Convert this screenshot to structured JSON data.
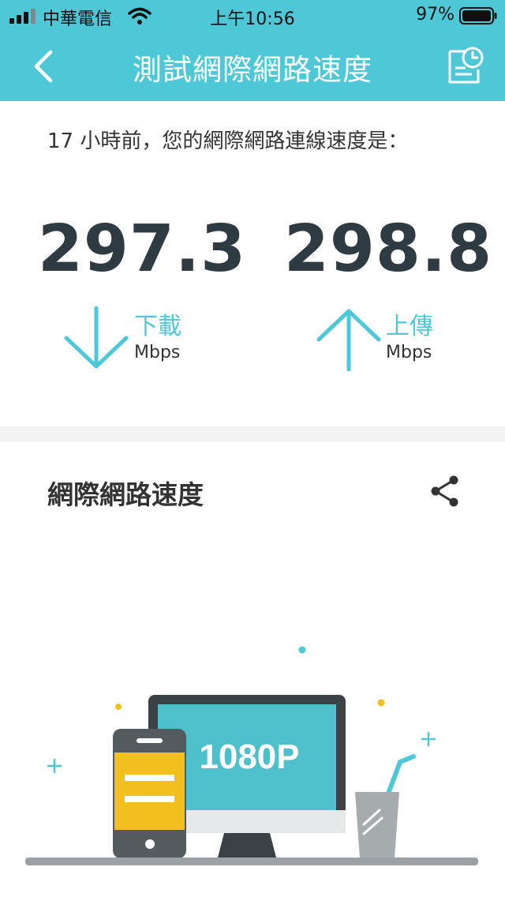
{
  "status_bar": {
    "carrier": "中華電信",
    "time": "上午10:56",
    "battery": "97%"
  },
  "header": {
    "title": "測試網際網路速度",
    "back_icon": "chevron-left-icon",
    "history_icon": "history-report-icon"
  },
  "result": {
    "subtitle": "17 小時前，您的網際網路連線速度是：",
    "download": {
      "value": "297.3",
      "label": "下載",
      "unit": "Mbps"
    },
    "upload": {
      "value": "298.8",
      "label": "上傳",
      "unit": "Mbps"
    }
  },
  "section": {
    "title": "網際網路速度",
    "share_icon": "share-icon"
  },
  "illustration": {
    "monitor_text": "1080P"
  },
  "colors": {
    "accent": "#4ec8d6",
    "dark": "#2e3b43",
    "yellow": "#f2c01e"
  }
}
